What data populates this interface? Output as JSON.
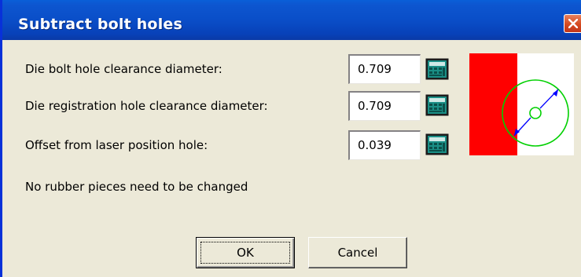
{
  "window": {
    "title": "Subtract bolt holes"
  },
  "fields": [
    {
      "label": "Die bolt hole clearance diameter:",
      "value": "0.709",
      "calc_icon": "calculator-icon"
    },
    {
      "label": "Die registration hole clearance diameter:",
      "value": "0.709",
      "calc_icon": "calculator-icon"
    },
    {
      "label": "Offset from laser position hole:",
      "value": "0.039",
      "calc_icon": "calculator-icon"
    }
  ],
  "status_text": "No rubber pieces need to be changed",
  "buttons": {
    "ok": "OK",
    "cancel": "Cancel"
  },
  "colors": {
    "title_bar": "#0a4ec8",
    "diagram_red": "#ff0000",
    "diagram_circle": "#00d000",
    "diagram_arrow": "#0000ff",
    "calc_icon": "#0a8f84"
  }
}
